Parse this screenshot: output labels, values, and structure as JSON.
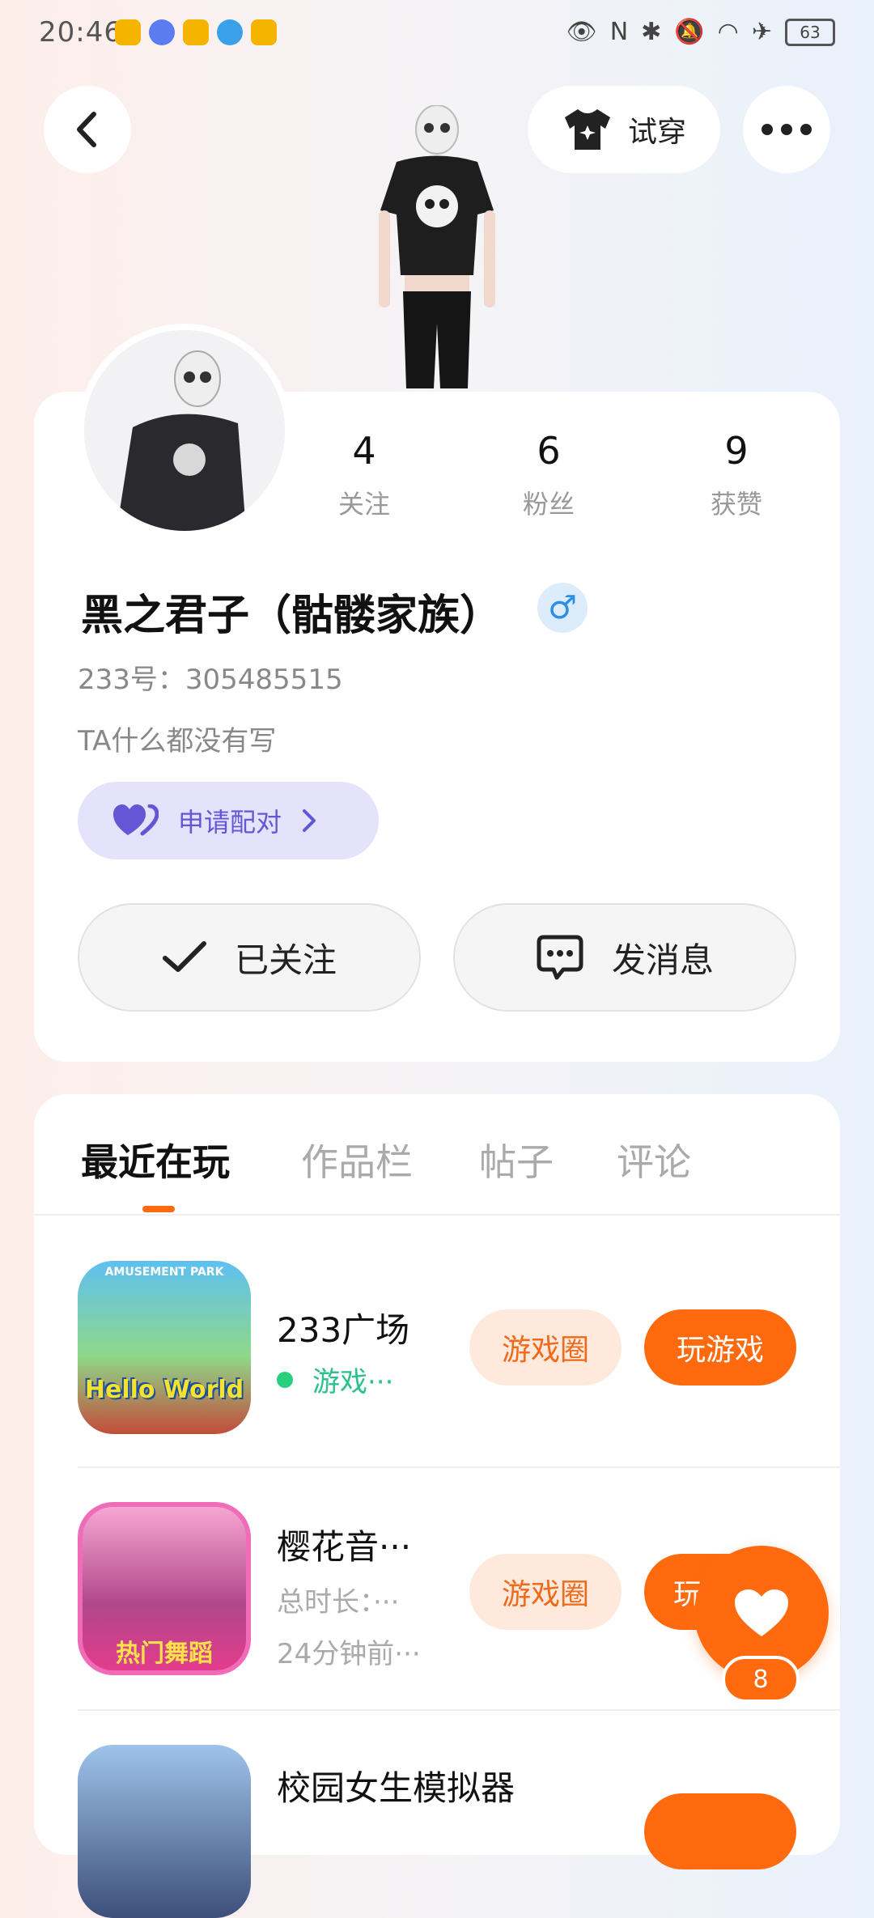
{
  "status_bar": {
    "time": "20:46",
    "battery": "63"
  },
  "header": {
    "try_on_label": "试穿"
  },
  "profile": {
    "stats": [
      {
        "value": "4",
        "label": "关注"
      },
      {
        "value": "6",
        "label": "粉丝"
      },
      {
        "value": "9",
        "label": "获赞"
      }
    ],
    "name": "黑之君子（骷髅家族）",
    "gender_symbol": "♂",
    "uid": "233号：305485515",
    "bio": "TA什么都没有写",
    "pair_label": "申请配对",
    "follow_label": "已关注",
    "message_label": "发消息"
  },
  "tabs": [
    {
      "label": "最近在玩"
    },
    {
      "label": "作品栏"
    },
    {
      "label": "帖子"
    },
    {
      "label": "评论"
    }
  ],
  "games": [
    {
      "title": "233广场",
      "status": "游戏···",
      "icon_text": "Hello World",
      "icon_caption": "AMUSEMENT PARK",
      "circle_label": "游戏圈",
      "play_label": "玩游戏"
    },
    {
      "title": "樱花音···",
      "duration": "总时长：···",
      "time_ago": "24分钟前···",
      "icon_text": "热门舞蹈",
      "circle_label": "游戏圈",
      "play_label": "玩"
    },
    {
      "title": "校园女生模拟器"
    }
  ],
  "like_fab": {
    "count": "8"
  },
  "colors": {
    "accent": "#ff6a0f",
    "pair": "#6357d6",
    "gender": "#2d8ee9",
    "online": "#26d07c"
  }
}
